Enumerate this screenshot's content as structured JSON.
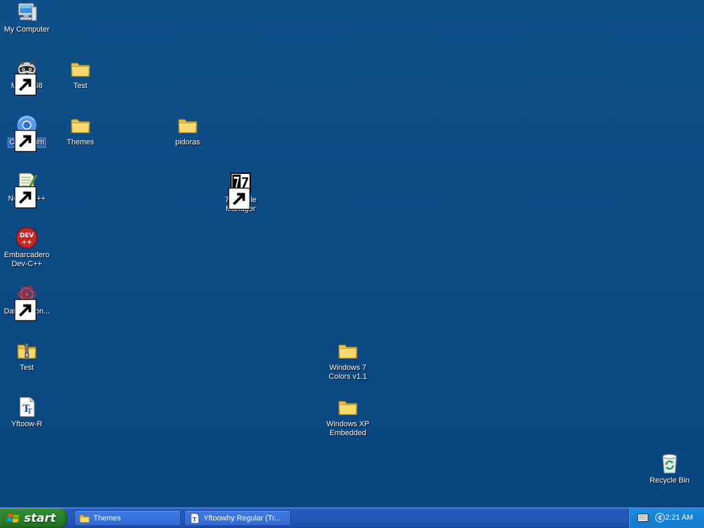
{
  "desktop": {
    "background_color": "#0e4d86",
    "icons": [
      {
        "label": "My Computer",
        "icon": "computer-icon",
        "shortcut": false
      },
      {
        "label": "MyPal 68",
        "icon": "raccoon-browser-icon",
        "shortcut": true
      },
      {
        "label": "Test",
        "icon": "folder-icon",
        "shortcut": false
      },
      {
        "label": "Chromium",
        "icon": "chromium-icon",
        "shortcut": true,
        "selected": true
      },
      {
        "label": "Themes",
        "icon": "folder-icon",
        "shortcut": false
      },
      {
        "label": "pidoras",
        "icon": "folder-icon",
        "shortcut": false
      },
      {
        "label": "Notepad++",
        "icon": "notepadpp-icon",
        "shortcut": true
      },
      {
        "label": "7-Zip File Manager",
        "icon": "7zip-icon",
        "shortcut": true
      },
      {
        "label": "Embarcadero Dev-C++",
        "icon": "devcpp-icon",
        "shortcut": false
      },
      {
        "label": "DataWagon...",
        "icon": "datawagon-icon",
        "shortcut": true
      },
      {
        "label": "Test",
        "icon": "zip-folder-icon",
        "shortcut": false
      },
      {
        "label": "Windows 7 Colors v1.1",
        "icon": "folder-icon",
        "shortcut": false
      },
      {
        "label": "Yftoow-R",
        "icon": "font-file-icon",
        "shortcut": false
      },
      {
        "label": "Windows XP Embedded",
        "icon": "folder-icon",
        "shortcut": false
      },
      {
        "label": "Recycle Bin",
        "icon": "recycle-bin-icon",
        "shortcut": false
      }
    ]
  },
  "taskbar": {
    "start_label": "start",
    "tasks": [
      {
        "label": "Themes",
        "icon": "folder-icon"
      },
      {
        "label": "Yftoowhy Regular (Tr...",
        "icon": "font-file-icon"
      }
    ],
    "tray": {
      "keyboard_icon": "keyboard-icon",
      "expand_icon": "chevron-left-icon",
      "clock": "2:21 AM"
    }
  }
}
